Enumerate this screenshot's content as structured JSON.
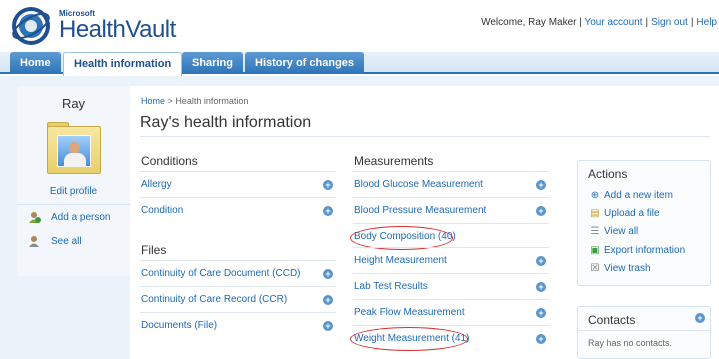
{
  "brand": {
    "company": "Microsoft",
    "product": "HealthVault"
  },
  "header": {
    "welcome": "Welcome, Ray Maker |",
    "links": [
      "Your account",
      "Sign out",
      "Help"
    ]
  },
  "tabs": [
    {
      "label": "Home",
      "active": false
    },
    {
      "label": "Health information",
      "active": true
    },
    {
      "label": "Sharing",
      "active": false
    },
    {
      "label": "History of changes",
      "active": false
    }
  ],
  "profile": {
    "name": "Ray",
    "edit_label": "Edit profile",
    "links": [
      "Add a person",
      "See all"
    ]
  },
  "breadcrumb": {
    "home": "Home",
    "separator": ">",
    "current": "Health information"
  },
  "page_title": "Ray's health information",
  "sections": {
    "conditions": {
      "title": "Conditions",
      "items": [
        "Allergy",
        "Condition"
      ]
    },
    "files": {
      "title": "Files",
      "items": [
        "Continuity of Care Document (CCD)",
        "Continuity of Care Record (CCR)",
        "Documents (File)"
      ]
    },
    "measurements": {
      "title": "Measurements",
      "items": [
        "Blood Glucose Measurement",
        "Blood Pressure Measurement",
        "Body Composition (40)",
        "Height Measurement",
        "Lab Test Results",
        "Peak Flow Measurement",
        "Weight Measurement (41)"
      ]
    }
  },
  "actions": {
    "title": "Actions",
    "items": [
      "Add a new item",
      "Upload a file",
      "View all",
      "Export information",
      "View trash"
    ]
  },
  "contacts": {
    "title": "Contacts",
    "empty": "Ray has no contacts."
  },
  "colors": {
    "link": "#1d6ab6",
    "tab": "#2f74b8",
    "highlight": "#d52b2b",
    "background": "#eaf2fa"
  },
  "icons": {
    "add": "+",
    "add_person": "add-person-icon",
    "see_all": "person-icon",
    "add_item": "plus-circle-icon",
    "upload": "upload-icon",
    "view_all": "list-icon",
    "export": "export-icon",
    "trash": "trash-icon"
  }
}
